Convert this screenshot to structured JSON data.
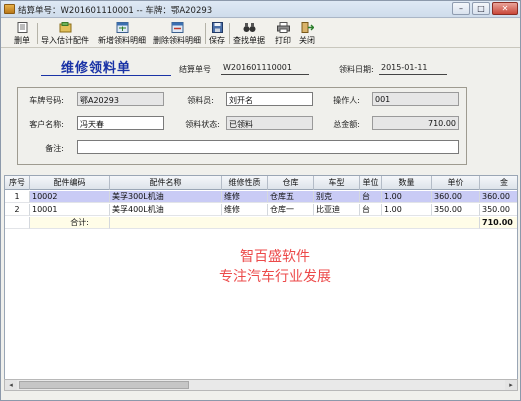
{
  "window": {
    "title": "结算单号：W201601110001 -- 车牌：鄂A20293",
    "min_btn": "–",
    "max_btn": "□",
    "close_btn": "✕"
  },
  "toolbar": {
    "items": [
      {
        "label": "删单",
        "icon": "delete-doc-icon"
      },
      {
        "label": "导入估计配件",
        "icon": "import-icon"
      },
      {
        "label": "新增领料明细",
        "icon": "add-detail-icon"
      },
      {
        "label": "删除领料明细",
        "icon": "remove-detail-icon"
      },
      {
        "label": "保存",
        "icon": "save-icon"
      },
      {
        "label": "查找单据",
        "icon": "binoculars-icon"
      },
      {
        "label": "打印",
        "icon": "printer-icon"
      },
      {
        "label": "关闭",
        "icon": "exit-icon"
      }
    ]
  },
  "header": {
    "doc_title": "维修领料单",
    "settle_label": "结算单号",
    "settle_value": "W201601110001",
    "date_label": "领料日期:",
    "date_value": "2015-01-11"
  },
  "form": {
    "plate_label": "车牌号码:",
    "plate_value": "鄂A20293",
    "picker_label": "领料员:",
    "picker_value": "刘开名",
    "operator_label": "操作人:",
    "operator_value": "001",
    "customer_label": "客户名称:",
    "customer_value": "冯天春",
    "status_label": "领料状态:",
    "status_value": "已领料",
    "total_label": "总金额:",
    "total_value": "710.00",
    "note_label": "备注:",
    "note_value": ""
  },
  "grid": {
    "columns": [
      "序号",
      "配件编码",
      "配件名称",
      "维修性质",
      "仓库",
      "车型",
      "单位",
      "数量",
      "单价",
      "金"
    ],
    "rows": [
      {
        "idx": "1",
        "code": "10002",
        "name": "美孚300L机油",
        "nature": "维修",
        "warehouse": "仓库五",
        "model": "别克",
        "unit": "台",
        "qty": "1.00",
        "price": "360.00",
        "amount": "360.00"
      },
      {
        "idx": "2",
        "code": "10001",
        "name": "美孚400L机油",
        "nature": "维修",
        "warehouse": "仓库一",
        "model": "比亚迪",
        "unit": "台",
        "qty": "1.00",
        "price": "350.00",
        "amount": "350.00"
      }
    ],
    "total_label": "合计:",
    "total_amount": "710.00"
  },
  "watermark": {
    "line1": "智百盛软件",
    "line2": "专注汽车行业发展"
  },
  "scrollbar": {
    "left": "◂",
    "right": "▸"
  }
}
